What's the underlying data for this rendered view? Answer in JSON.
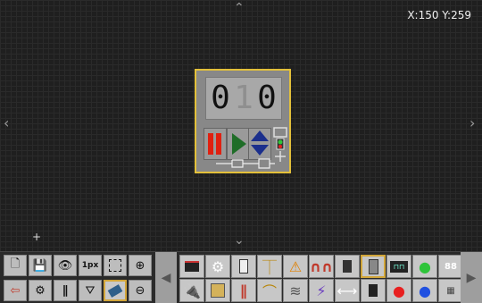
{
  "canvas": {
    "coords": "X:150 Y:259"
  },
  "counter": {
    "digits": [
      "0",
      "1",
      "0"
    ],
    "dim_digit_index": 1
  },
  "icons": {
    "pan_up": "chevron-up-icon",
    "pan_down": "chevron-down-icon",
    "pan_left": "chevron-left-icon",
    "pan_right": "chevron-right-icon",
    "crosshair": "crosshair-icon"
  },
  "toolbar": {
    "line_width_label": "1px",
    "tools_row1": [
      "new-file",
      "save",
      "view",
      "line-width",
      "select-area",
      "zoom-in"
    ],
    "tools_row2": [
      "exit",
      "settings",
      "pause",
      "tap",
      "eraser",
      "zoom-out"
    ],
    "parts_row1": [
      "battery",
      "generator",
      "switch",
      "wire-junction",
      "laser-hazard",
      "heater-coil",
      "power-plug-dark",
      "battery-cell",
      "oscilloscope",
      "green-led",
      "ic-chip-88"
    ],
    "parts_row2": [
      "power-plug",
      "transformer-box",
      "probes",
      "wire-bend",
      "coil",
      "spark-gap",
      "resistor-arrow",
      "ic-chip",
      "red-led",
      "blue-led",
      "chip-array"
    ],
    "ic_label": "88"
  },
  "colors": {
    "accent": "#e3c03a",
    "led_red": "#e82020",
    "led_green": "#2ec43a",
    "led_blue": "#2050e0",
    "play": "#1f6d28",
    "arrows": "#1b2f8c"
  }
}
